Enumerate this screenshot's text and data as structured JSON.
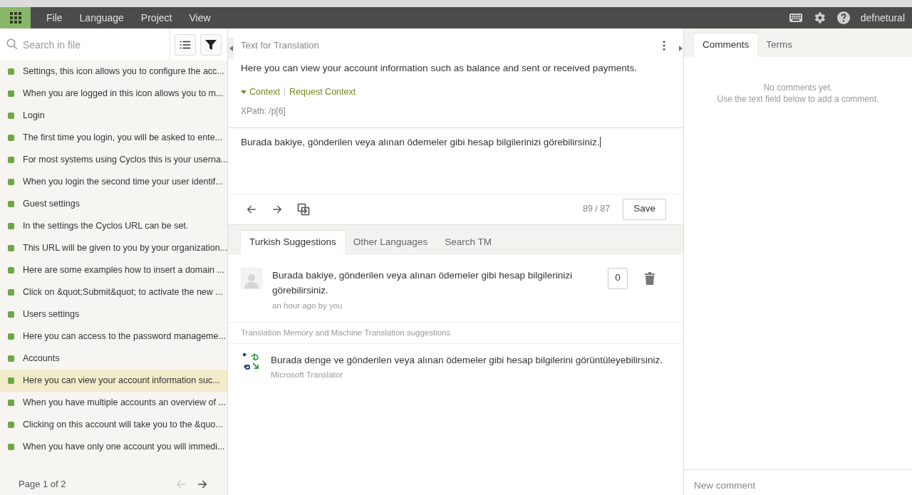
{
  "menu": {
    "items": [
      "File",
      "Language",
      "Project",
      "View"
    ],
    "user": "defnetural"
  },
  "sidebar": {
    "search_placeholder": "Search in file",
    "items": [
      {
        "text": "Settings, this icon allows you to configure the acc...",
        "selected": false
      },
      {
        "text": "When you are logged in this icon allows you to m...",
        "selected": false
      },
      {
        "text": "Login",
        "selected": false
      },
      {
        "text": "The first time you login, you will be asked to ente...",
        "selected": false
      },
      {
        "text": "For most systems using Cyclos this is your userna...",
        "selected": false
      },
      {
        "text": "When you login the second time your user identif...",
        "selected": false
      },
      {
        "text": "Guest settings",
        "selected": false
      },
      {
        "text": "In the settings the Cyclos URL can be set.",
        "selected": false
      },
      {
        "text": "This URL will be given to you by your organization...",
        "selected": false
      },
      {
        "text": "Here are some examples how to insert a domain ...",
        "selected": false
      },
      {
        "text": "Click on &quot;Submit&quot; to activate the new ...",
        "selected": false
      },
      {
        "text": "Users settings",
        "selected": false
      },
      {
        "text": "Here you can access to the password manageme...",
        "selected": false
      },
      {
        "text": "Accounts",
        "selected": false
      },
      {
        "text": "Here you can view your account information suc...",
        "selected": true
      },
      {
        "text": "When you have multiple accounts an overview of ...",
        "selected": false
      },
      {
        "text": "Clicking on this account will take you to the &quo...",
        "selected": false
      },
      {
        "text": "When you have only one account you will immedi...",
        "selected": false
      }
    ],
    "pager": "Page 1 of 2"
  },
  "editor": {
    "title": "Text for Translation",
    "source": "Here you can view your account information such as balance and sent or received payments.",
    "context_expanded": true,
    "context_label": "Context",
    "request_context_label": "Request Context",
    "xpath": "XPath: /p[6]",
    "translation": "Burada bakiye, gönderilen veya alınan ödemeler gibi hesap bilgilerinizi görebilirsiniz.",
    "counter": "89 / 87",
    "save_label": "Save",
    "suggestion_tabs": [
      {
        "label": "Turkish Suggestions",
        "selected": true
      },
      {
        "label": "Other Languages",
        "selected": false
      },
      {
        "label": "Search TM",
        "selected": false
      }
    ],
    "suggestions": [
      {
        "text": "Burada bakiye, gönderilen veya alınan ödemeler gibi hesap bilgilerinizi görebilirsiniz.",
        "meta": "an hour ago by you",
        "votes": "0"
      }
    ],
    "tm_heading": "Translation Memory and Machine Translation suggestions",
    "tm_items": [
      {
        "text": "Burada denge ve gönderilen veya alınan ödemeler gibi hesap bilgilerini görüntüleyebilirsiniz.",
        "source": "Microsoft Translator"
      }
    ]
  },
  "comments": {
    "tabs": [
      {
        "label": "Comments",
        "selected": true
      },
      {
        "label": "Terms",
        "selected": false
      }
    ],
    "empty_lines": [
      "No comments yet.",
      "Use the text field below to add a comment."
    ],
    "new_comment_placeholder": "New comment"
  }
}
